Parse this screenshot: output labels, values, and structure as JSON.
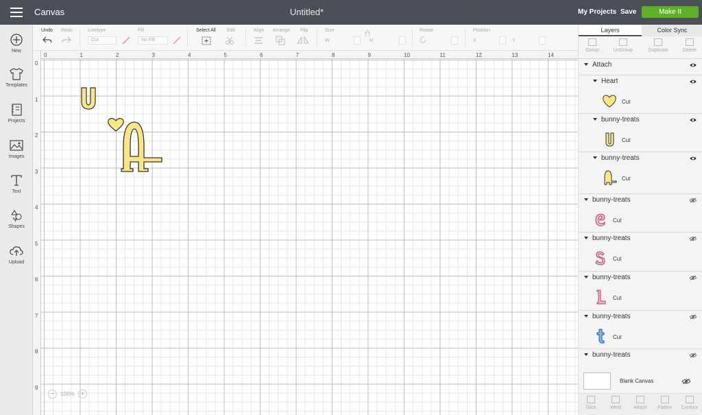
{
  "topbar": {
    "app_title": "Canvas",
    "doc_title": "Untitled*",
    "my_projects": "My Projects",
    "save": "Save",
    "make_it": "Make It"
  },
  "leftnav": [
    {
      "label": "New",
      "icon": "plus-circle-icon"
    },
    {
      "label": "Templates",
      "icon": "tshirt-icon"
    },
    {
      "label": "Projects",
      "icon": "projects-icon"
    },
    {
      "label": "Images",
      "icon": "image-icon"
    },
    {
      "label": "Text",
      "icon": "text-icon"
    },
    {
      "label": "Shapes",
      "icon": "shapes-icon"
    },
    {
      "label": "Upload",
      "icon": "upload-cloud-icon"
    }
  ],
  "toolbar": {
    "undo": "Undo",
    "redo": "Redo",
    "linetype": "Linetype",
    "linetype_value": "Cut",
    "fill": "Fill",
    "fill_value": "No Fill",
    "select_all": "Select All",
    "edit": "Edit",
    "align": "Align",
    "arrange": "Arrange",
    "flip": "Flip",
    "size": "Size",
    "size_w": "W",
    "size_h": "H",
    "rotate": "Rotate",
    "position": "Position",
    "pos_x": "X",
    "pos_y": "Y"
  },
  "rulers": {
    "top": [
      "0",
      "1",
      "2",
      "3",
      "4",
      "5",
      "6",
      "7",
      "8",
      "9",
      "10",
      "11",
      "12",
      "13",
      "14"
    ],
    "left": [
      "0",
      "1",
      "2",
      "3",
      "4",
      "5",
      "6",
      "7",
      "8",
      "9"
    ]
  },
  "zoom": {
    "minus": "−",
    "value": "100%",
    "plus": "+"
  },
  "panel": {
    "tabs": [
      "Layers",
      "Color Sync"
    ],
    "tools": [
      "Group",
      "UnGroup",
      "Duplicate",
      "Delete"
    ],
    "bottom_tools": [
      "Slice",
      "Weld",
      "Attach",
      "Flatten",
      "Contour"
    ],
    "layers": [
      {
        "name": "Attach",
        "visible": true
      },
      {
        "name": "Heart",
        "op": "Cut",
        "visible": true,
        "color": "#f8e784"
      },
      {
        "name": "bunny-treats",
        "op": "Cut",
        "visible": true,
        "color": "#f8e784"
      },
      {
        "name": "bunny-treats",
        "op": "Cut",
        "visible": true,
        "color": "#f8e784"
      },
      {
        "name": "bunny-treats",
        "op": "Cut",
        "visible": false,
        "color": "#f6b8c8"
      },
      {
        "name": "bunny-treats",
        "op": "Cut",
        "visible": false,
        "color": "#f6b8c8"
      },
      {
        "name": "bunny-treats",
        "op": "Cut",
        "visible": false,
        "color": "#f6b8c8"
      },
      {
        "name": "bunny-treats",
        "op": "Cut",
        "visible": false,
        "color": "#7fb8e8"
      },
      {
        "name": "bunny-treats",
        "visible": false
      }
    ],
    "blank_canvas": "Blank Canvas"
  },
  "colors": {
    "topbar": "#4a5055",
    "make_it": "#5eb026",
    "yellow_fill": "#f8e784"
  }
}
